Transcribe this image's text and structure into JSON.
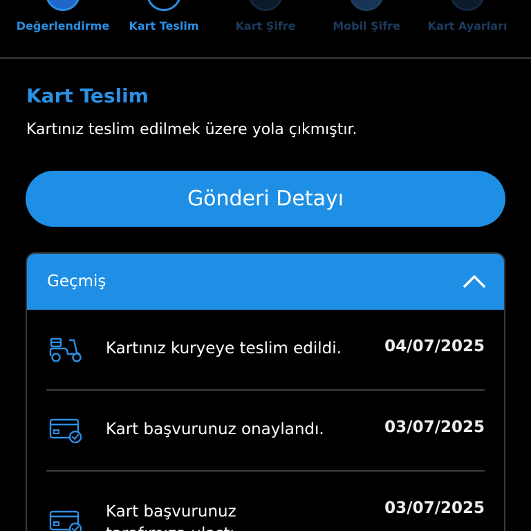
{
  "stepper": {
    "steps": [
      {
        "label": "Değerlendirme",
        "state": "done"
      },
      {
        "label": "Kart Teslim",
        "state": "current"
      },
      {
        "label": "Kart Şifre",
        "state": "future"
      },
      {
        "label": "Mobil Şifre",
        "state": "future"
      },
      {
        "label": "Kart Ayarları",
        "state": "future"
      }
    ]
  },
  "section": {
    "title": "Kart Teslim",
    "description": "Kartınız teslim edilmek üzere yola çıkmıştır."
  },
  "primary_button": {
    "label": "Gönderi Detayı"
  },
  "history": {
    "title": "Geçmiş",
    "items": [
      {
        "icon": "courier-scooter-icon",
        "text": "Kartınız kuryeye teslim edildi.",
        "date": "04/07/2025"
      },
      {
        "icon": "card-check-icon",
        "text": "Kart başvurunuz onaylandı.",
        "date": "03/07/2025"
      },
      {
        "icon": "card-check-icon",
        "text": "Kart başvurunuz tarafımıza ulaştı.",
        "date": "03/07/2025"
      }
    ]
  },
  "colors": {
    "accent": "#1e8fe5",
    "accent_text": "#2b8fe3",
    "inactive_text": "#1d3b5e",
    "background": "#000000"
  }
}
